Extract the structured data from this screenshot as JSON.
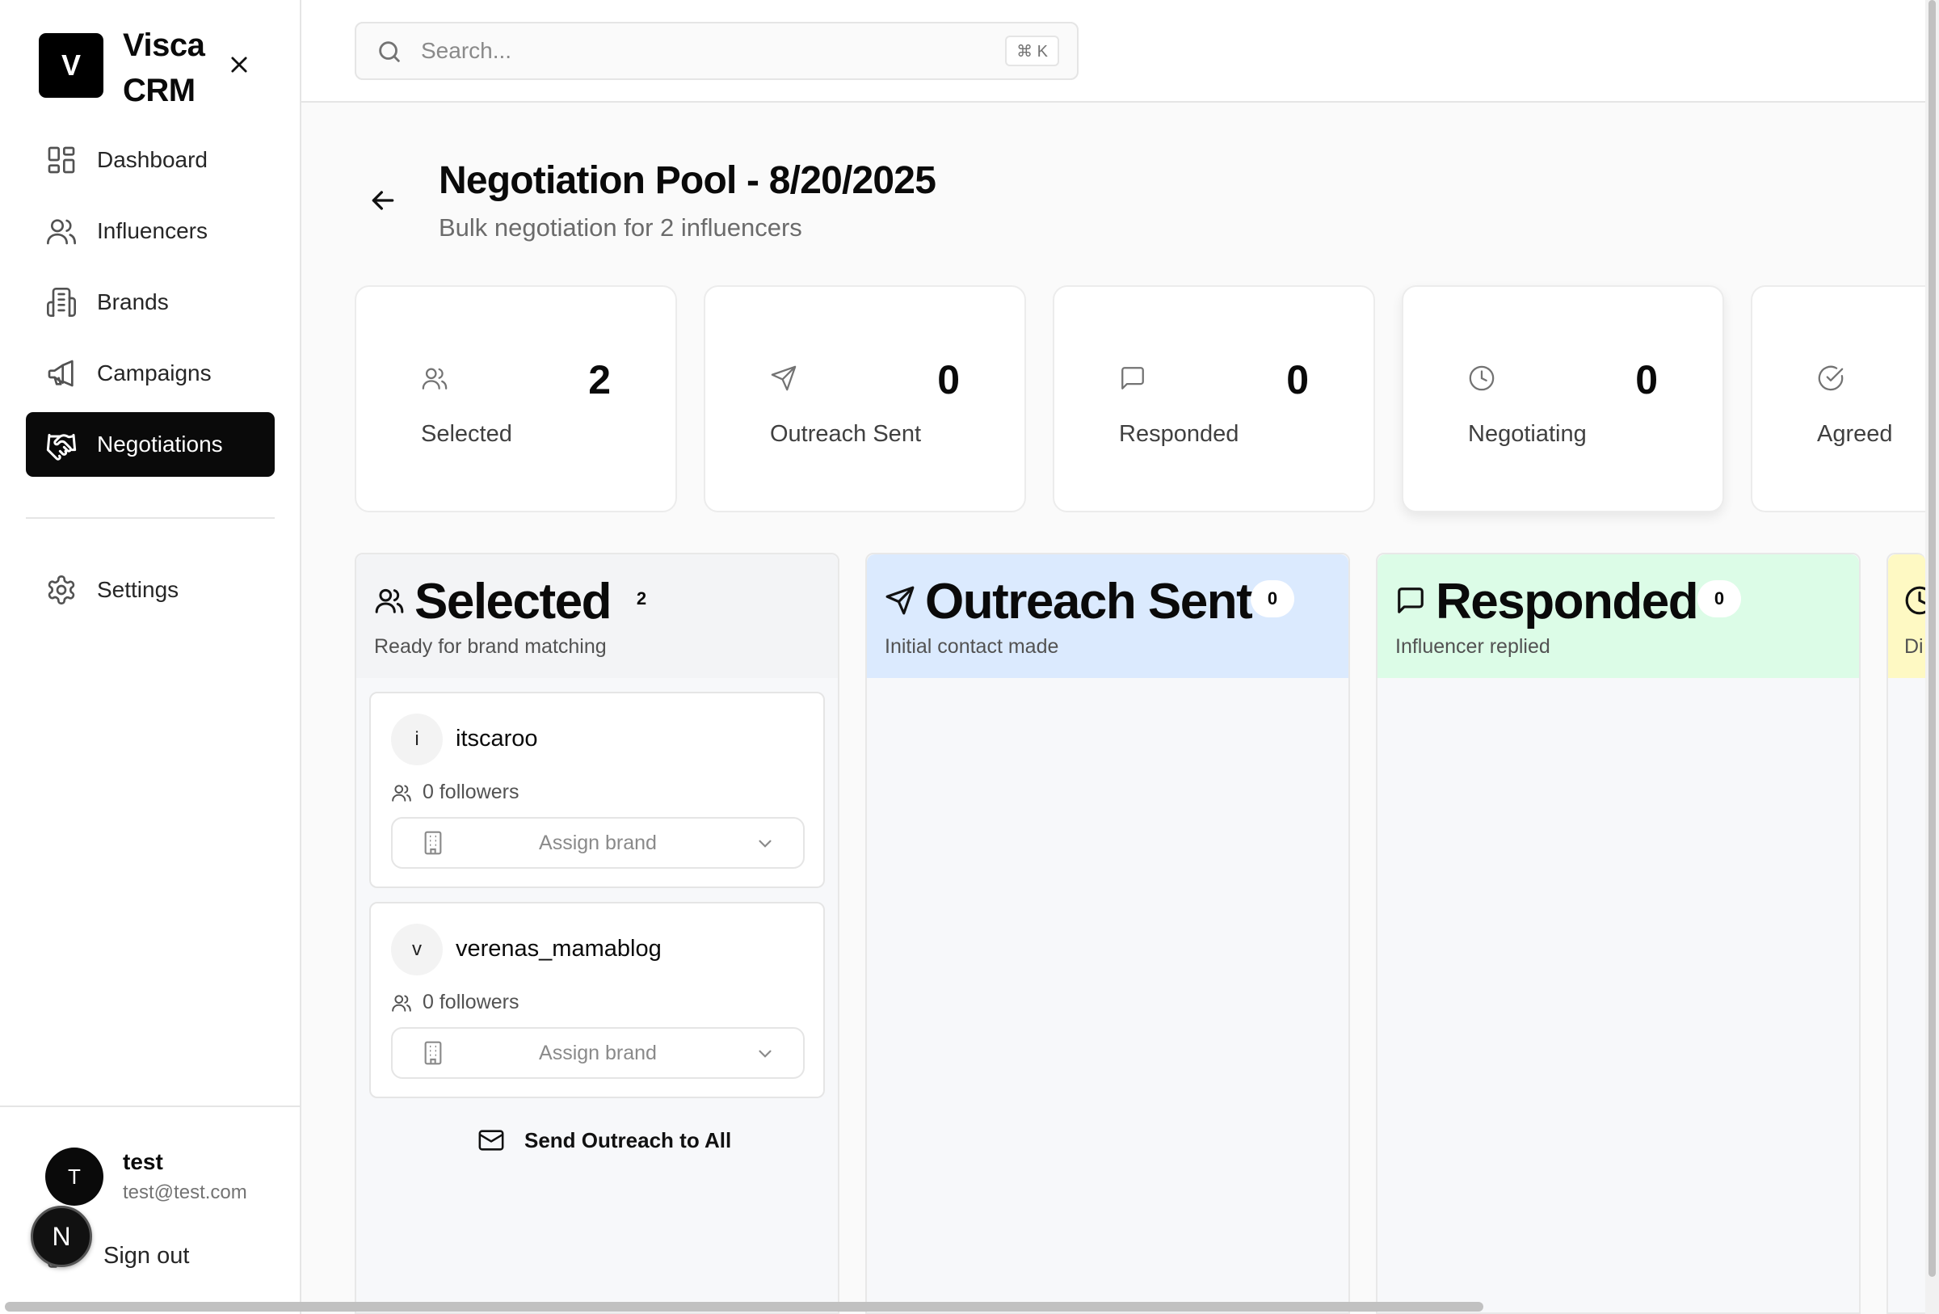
{
  "app": {
    "logo_letter": "V",
    "name": "Visca CRM"
  },
  "nav": {
    "items": [
      {
        "label": "Dashboard",
        "icon": "dashboard-icon"
      },
      {
        "label": "Influencers",
        "icon": "users-icon"
      },
      {
        "label": "Brands",
        "icon": "building-icon"
      },
      {
        "label": "Campaigns",
        "icon": "megaphone-icon"
      },
      {
        "label": "Negotiations",
        "icon": "handshake-icon",
        "active": true
      }
    ],
    "settings_label": "Settings"
  },
  "user": {
    "initial": "T",
    "name": "test",
    "email": "test@test.com",
    "signout_label": "Sign out",
    "floating_badge": "N"
  },
  "search": {
    "placeholder": "Search...",
    "shortcut": "⌘ K"
  },
  "page": {
    "title": "Negotiation Pool - 8/20/2025",
    "subtitle": "Bulk negotiation for 2 influencers"
  },
  "stats": [
    {
      "label": "Selected",
      "value": "2",
      "icon": "users-icon"
    },
    {
      "label": "Outreach Sent",
      "value": "0",
      "icon": "send-icon"
    },
    {
      "label": "Responded",
      "value": "0",
      "icon": "message-icon"
    },
    {
      "label": "Negotiating",
      "value": "0",
      "icon": "clock-icon"
    },
    {
      "label": "Agreed",
      "value": "",
      "icon": "check-circle-icon"
    }
  ],
  "columns": [
    {
      "title": "Selected",
      "count": "2",
      "description": "Ready for brand matching",
      "icon": "users-icon",
      "color": "#f3f4f6",
      "cards": [
        {
          "initial": "i",
          "name": "itscaroo",
          "followers": "0 followers",
          "assign_label": "Assign brand"
        },
        {
          "initial": "v",
          "name": "verenas_mamablog",
          "followers": "0 followers",
          "assign_label": "Assign brand"
        }
      ],
      "action_label": "Send Outreach to All"
    },
    {
      "title": "Outreach Sent",
      "count": "0",
      "description": "Initial contact made",
      "icon": "send-icon",
      "color": "#dbeafe",
      "cards": []
    },
    {
      "title": "Responded",
      "count": "0",
      "description": "Influencer replied",
      "icon": "message-icon",
      "color": "#dcfce7",
      "cards": []
    },
    {
      "title": "",
      "count": "",
      "description": "Di",
      "icon": "clock-icon",
      "color": "#fef9c3",
      "cards": []
    }
  ],
  "colors": {
    "active_nav_bg": "#0a0a0a",
    "selected_col": "#f3f4f6",
    "outreach_col": "#dbeafe",
    "responded_col": "#dcfce7",
    "negotiating_col": "#fef9c3"
  }
}
